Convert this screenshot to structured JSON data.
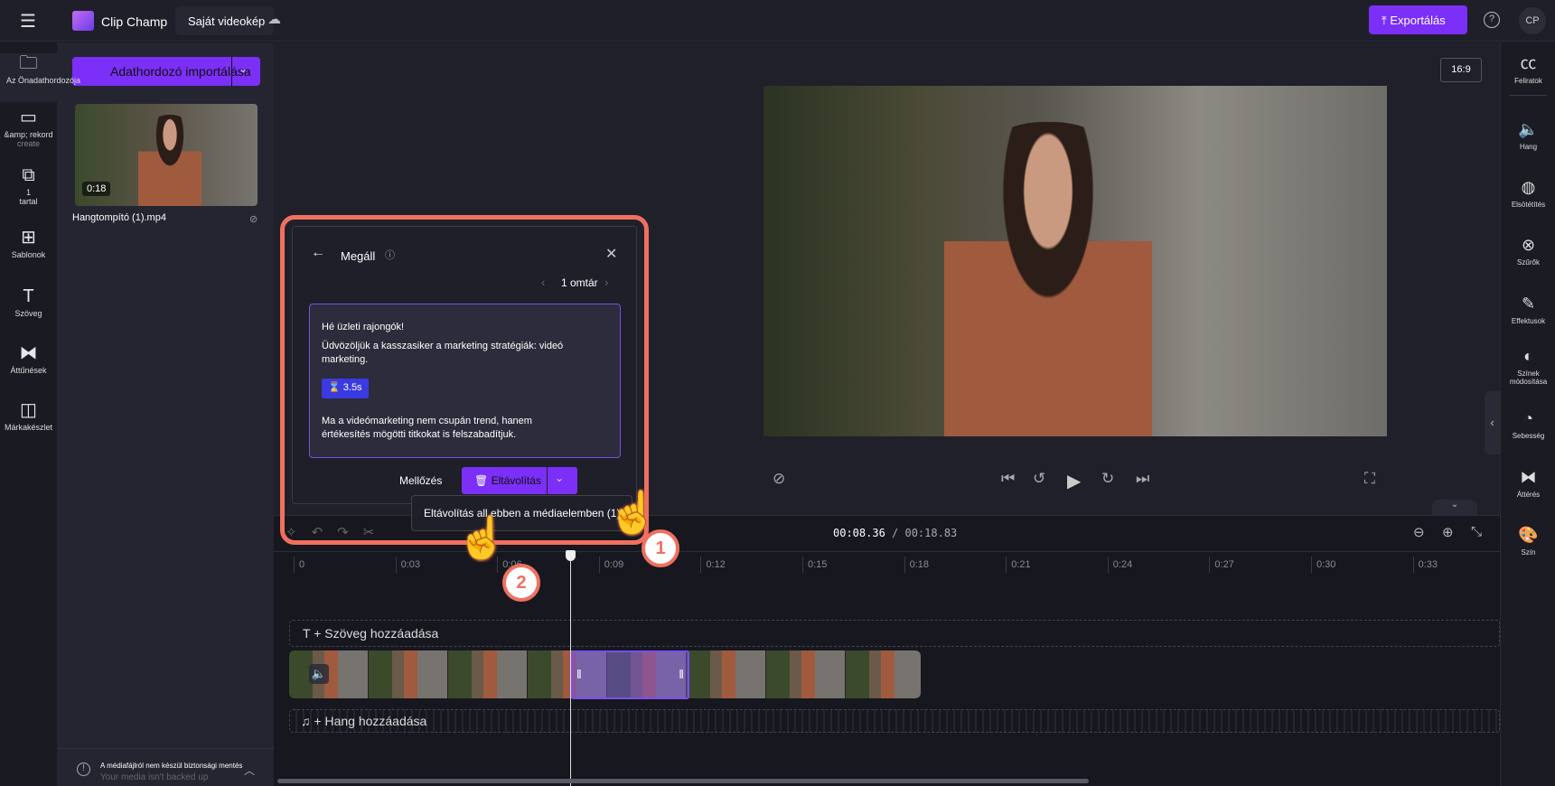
{
  "header": {
    "app_name": "Clip Champ",
    "project_title": "Saját videokép",
    "export_label": "Exportálás",
    "avatar": "CP"
  },
  "left_rail": [
    {
      "label": "Az Önadathordozója",
      "icon": "folder-icon"
    },
    {
      "label": "&amp; rekord",
      "sub": "create",
      "icon": "video-camera-icon"
    },
    {
      "label": "1",
      "sub": "tartal",
      "icon": "content-library-icon"
    },
    {
      "label": "Sablonok",
      "icon": "templates-icon"
    },
    {
      "label": "Szöveg",
      "icon": "text-icon"
    },
    {
      "label": "Áttűnések",
      "icon": "transitions-icon"
    },
    {
      "label": "Márkakészlet",
      "icon": "brand-kit-icon"
    }
  ],
  "media": {
    "import_label": "Adathordozó importálása",
    "item": {
      "duration": "0:18",
      "filename": "Hangtompító (1).mp4"
    },
    "backup_notice": "A médiafájlról nem készül biztonsági mentés",
    "backup_notice_under": "Your media isn't backed up"
  },
  "preview": {
    "aspect_ratio": "16:9"
  },
  "right_sidebar": [
    {
      "label": "Feliratok",
      "icon": "cc-icon"
    },
    {
      "label": "Hang",
      "icon": "speaker-icon"
    },
    {
      "label": "Elsötétítés",
      "icon": "fade-icon"
    },
    {
      "label": "Szűrők",
      "icon": "filters-icon"
    },
    {
      "label": "Effektusok",
      "icon": "magic-wand-icon"
    },
    {
      "label": "Színek módosítása",
      "icon": "contrast-icon"
    },
    {
      "label": "Sebesség",
      "icon": "speedometer-icon"
    },
    {
      "label": "Áttérés",
      "icon": "transition-icon"
    },
    {
      "label": "Szín",
      "icon": "palette-icon"
    }
  ],
  "popup": {
    "title": "Megáll",
    "pager": "1 omtár",
    "transcript_line1": "Hé üzleti rajongók!",
    "transcript_line2": "Üdvözöljük a kasszasiker a marketing stratégiák: videó marketing.",
    "pause_badge": "3.5s",
    "transcript_line3": "Ma a videómarketing nem csupán trend, hanem értékesítés mögötti titkokat is felszabadítjuk.",
    "ignore_label": "Mellőzés",
    "remove_label": "Eltávolítás",
    "menu_item": "Eltávolítás all ebben a médiaelemben (1)",
    "step1": "1",
    "step2": "2"
  },
  "timeline": {
    "current_time": "00:08.36",
    "total_time": "/ 00:18.83",
    "ticks": [
      "0",
      "0:03",
      "0:06",
      "0:09",
      "0:12",
      "0:15",
      "0:18",
      "0:21",
      "0:24",
      "0:27",
      "0:30",
      "0:33"
    ],
    "add_text": "T + Szöveg hozzáadása",
    "add_audio": "+ Hang hozzáadása"
  },
  "colors": {
    "accent": "#7b2ff7",
    "highlight": "#f0705f"
  }
}
